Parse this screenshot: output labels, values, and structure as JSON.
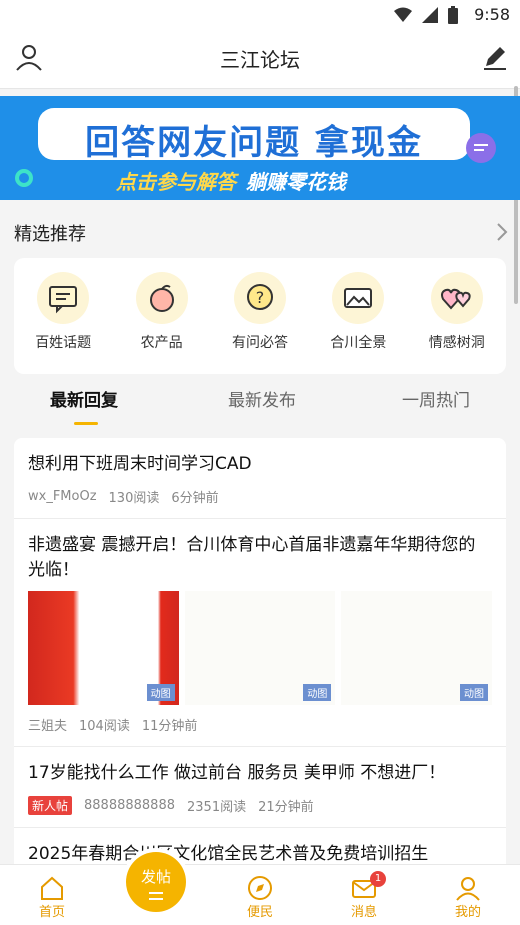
{
  "status": {
    "time": "9:58"
  },
  "header": {
    "title": "三江论坛",
    "user_icon": "user-icon",
    "edit_icon": "edit-icon"
  },
  "banner": {
    "title": "回答网友问题 拿现金",
    "sub_a": "点击参与解答",
    "sub_b": "躺赚零花钱"
  },
  "featured": {
    "title": "精选推荐"
  },
  "categories": [
    {
      "label": "百姓话题",
      "icon": "chat-icon"
    },
    {
      "label": "农产品",
      "icon": "peach-icon"
    },
    {
      "label": "有问必答",
      "icon": "question-icon"
    },
    {
      "label": "合川全景",
      "icon": "panorama-icon"
    },
    {
      "label": "情感树洞",
      "icon": "hearts-icon"
    }
  ],
  "tabs": [
    {
      "label": "最新回复",
      "active": true
    },
    {
      "label": "最新发布",
      "active": false
    },
    {
      "label": "一周热门",
      "active": false
    }
  ],
  "posts": [
    {
      "title": "想利用下班周末时间学习CAD",
      "author": "wx_FMoOz",
      "reads": "130阅读",
      "time": "6分钟前"
    },
    {
      "title": "非遗盛宴 震撼开启！合川体育中心首届非遗嘉年华期待您的光临！",
      "author": "三姐夫",
      "reads": "104阅读",
      "time": "11分钟前",
      "image_tag": "动图"
    },
    {
      "title": "17岁能找什么工作 做过前台 服务员 美甲师 不想进厂！",
      "tag": "新人帖",
      "author": "88888888888",
      "reads": "2351阅读",
      "time": "21分钟前"
    },
    {
      "title": "2025年春期合川区文化馆全民艺术普及免费培训招生"
    }
  ],
  "nav": {
    "home": "首页",
    "post": "发帖",
    "service": "便民",
    "messages": "消息",
    "messages_badge": "1",
    "mine": "我的"
  },
  "colors": {
    "accent": "#f5b400",
    "banner": "#1f8fe8",
    "badge": "#e8423c"
  }
}
